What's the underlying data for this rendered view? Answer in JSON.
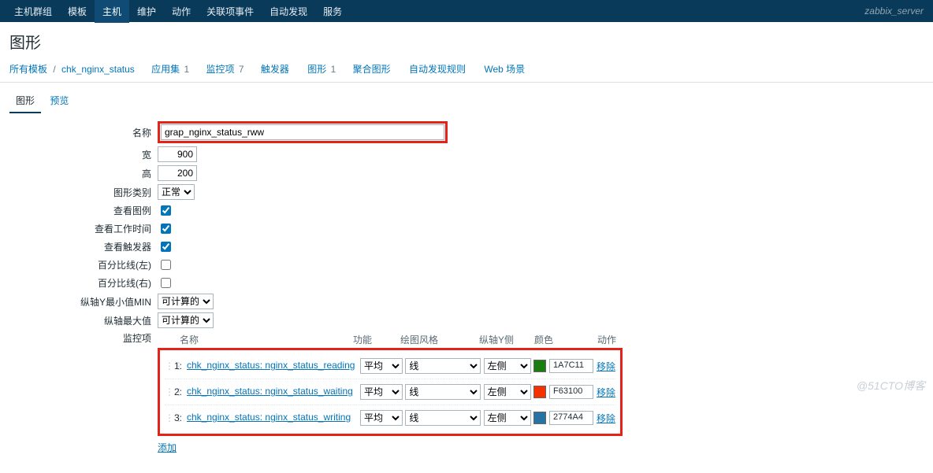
{
  "topnav": {
    "items": [
      "主机群组",
      "模板",
      "主机",
      "维护",
      "动作",
      "关联项事件",
      "自动发现",
      "服务"
    ],
    "active_index": 2,
    "server_label": "zabbix_server"
  },
  "page": {
    "title": "图形"
  },
  "breadcrumb": {
    "root": "所有模板",
    "sep": "/",
    "current": "chk_nginx_status"
  },
  "sublinks": [
    {
      "label": "应用集",
      "count": "1"
    },
    {
      "label": "监控项",
      "count": "7"
    },
    {
      "label": "触发器",
      "count": ""
    },
    {
      "label": "图形",
      "count": "1"
    },
    {
      "label": "聚合图形",
      "count": ""
    },
    {
      "label": "自动发现规则",
      "count": ""
    },
    {
      "label": "Web 场景",
      "count": ""
    }
  ],
  "tabs": {
    "items": [
      "图形",
      "预览"
    ],
    "active_index": 0
  },
  "form": {
    "labels": {
      "name": "名称",
      "width": "宽",
      "height": "高",
      "type": "图形类别",
      "legend": "查看图例",
      "worktime": "查看工作时间",
      "triggers": "查看触发器",
      "pct_left": "百分比线(左)",
      "pct_right": "百分比线(右)",
      "ymin": "纵轴Y最小值MIN",
      "ymax": "纵轴最大值",
      "items": "监控项"
    },
    "values": {
      "name": "grap_nginx_status_rww",
      "width": "900",
      "height": "200",
      "type": "正常",
      "legend": true,
      "worktime": true,
      "triggers": true,
      "pct_left": false,
      "pct_right": false,
      "ymin": "可计算的",
      "ymax": "可计算的"
    }
  },
  "items_table": {
    "headers": {
      "idx": "",
      "name": "名称",
      "fn": "功能",
      "style": "绘图风格",
      "side": "纵轴Y侧",
      "color": "颜色",
      "action": "动作"
    },
    "rows": [
      {
        "idx": "1:",
        "name": "chk_nginx_status: nginx_status_reading",
        "fn": "平均",
        "style": "线",
        "side": "左侧",
        "color_hex": "#1A7C11",
        "color": "1A7C11",
        "action": "移除"
      },
      {
        "idx": "2:",
        "name": "chk_nginx_status: nginx_status_waiting",
        "fn": "平均",
        "style": "线",
        "side": "左侧",
        "color_hex": "#F63100",
        "color": "F63100",
        "action": "移除"
      },
      {
        "idx": "3:",
        "name": "chk_nginx_status: nginx_status_writing",
        "fn": "平均",
        "style": "线",
        "side": "左侧",
        "color_hex": "#2774A4",
        "color": "2774A4",
        "action": "移除"
      }
    ],
    "add_label": "添加"
  },
  "watermark": "@51CTO博客"
}
